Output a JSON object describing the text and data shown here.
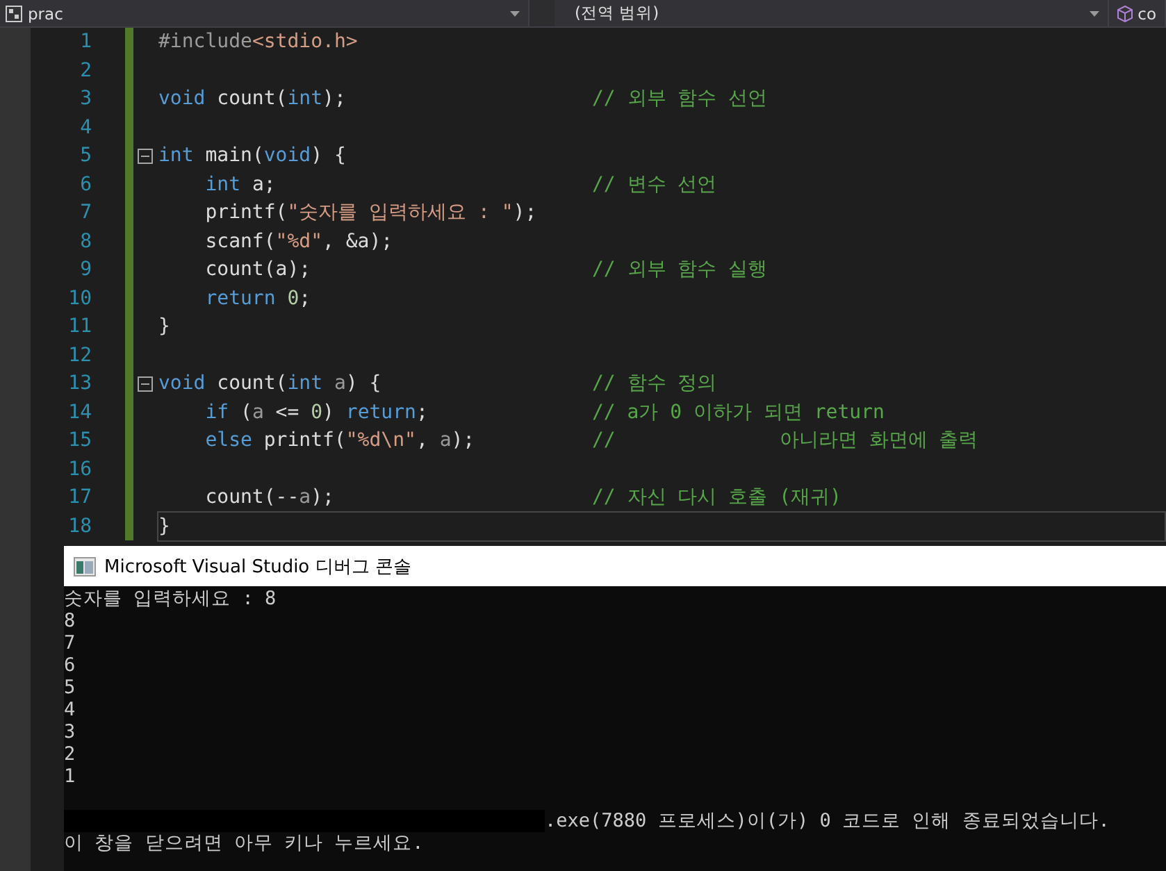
{
  "navigation_bar": {
    "project": "prac",
    "scope": "(전역 범위)",
    "member": "co"
  },
  "code_lines": [
    {
      "number": "1",
      "fold_marker": false,
      "tokens": [
        {
          "kind": "preproc",
          "text": "#include"
        },
        {
          "kind": "string",
          "text": "<stdio.h>"
        }
      ]
    },
    {
      "number": "2",
      "fold_marker": false
    },
    {
      "number": "3",
      "fold_marker": false,
      "tokens": [
        {
          "kind": "keyword",
          "text": "void"
        },
        {
          "kind": "plain",
          "text": " count("
        },
        {
          "kind": "keyword",
          "text": "int"
        },
        {
          "kind": "plain",
          "text": ");"
        }
      ],
      "comment": "// 외부 함수 선언"
    },
    {
      "number": "4",
      "fold_marker": false
    },
    {
      "number": "5",
      "fold_marker": true,
      "tokens": [
        {
          "kind": "keyword",
          "text": "int"
        },
        {
          "kind": "plain",
          "text": " main("
        },
        {
          "kind": "keyword",
          "text": "void"
        },
        {
          "kind": "plain",
          "text": ") {"
        }
      ]
    },
    {
      "number": "6",
      "fold_marker": false,
      "tokens": [
        {
          "kind": "keyword",
          "text": "    int"
        },
        {
          "kind": "plain",
          "text": " a;"
        }
      ],
      "comment": "// 변수 선언"
    },
    {
      "number": "7",
      "fold_marker": false,
      "tokens": [
        {
          "kind": "plain",
          "text": "    printf("
        },
        {
          "kind": "string",
          "text": "\"숫자를 입력하세요 : \""
        },
        {
          "kind": "plain",
          "text": ");"
        }
      ]
    },
    {
      "number": "8",
      "fold_marker": false,
      "tokens": [
        {
          "kind": "plain",
          "text": "    scanf("
        },
        {
          "kind": "string",
          "text": "\"%d\""
        },
        {
          "kind": "plain",
          "text": ", &a);"
        }
      ]
    },
    {
      "number": "9",
      "fold_marker": false,
      "tokens": [
        {
          "kind": "plain",
          "text": "    count(a);"
        }
      ],
      "comment": "// 외부 함수 실행"
    },
    {
      "number": "10",
      "fold_marker": false,
      "tokens": [
        {
          "kind": "keyword",
          "text": "    return"
        },
        {
          "kind": "number",
          "text": " 0"
        },
        {
          "kind": "plain",
          "text": ";"
        }
      ]
    },
    {
      "number": "11",
      "fold_marker": false,
      "tokens": [
        {
          "kind": "plain",
          "text": "}"
        }
      ]
    },
    {
      "number": "12",
      "fold_marker": false
    },
    {
      "number": "13",
      "fold_marker": true,
      "tokens": [
        {
          "kind": "keyword",
          "text": "void"
        },
        {
          "kind": "plain",
          "text": " count("
        },
        {
          "kind": "keyword",
          "text": "int"
        },
        {
          "kind": "param",
          "text": " a"
        },
        {
          "kind": "plain",
          "text": ") {"
        }
      ],
      "comment": "// 함수 정의"
    },
    {
      "number": "14",
      "fold_marker": false,
      "tokens": [
        {
          "kind": "keyword",
          "text": "    if"
        },
        {
          "kind": "plain",
          "text": " ("
        },
        {
          "kind": "param",
          "text": "a"
        },
        {
          "kind": "plain",
          "text": " <= "
        },
        {
          "kind": "number",
          "text": "0"
        },
        {
          "kind": "plain",
          "text": ") "
        },
        {
          "kind": "keyword",
          "text": "return"
        },
        {
          "kind": "plain",
          "text": ";"
        }
      ],
      "comment": "// a가 0 이하가 되면 return"
    },
    {
      "number": "15",
      "fold_marker": false,
      "tokens": [
        {
          "kind": "keyword",
          "text": "    else"
        },
        {
          "kind": "plain",
          "text": " printf("
        },
        {
          "kind": "string",
          "text": "\"%d\\n\""
        },
        {
          "kind": "plain",
          "text": ", "
        },
        {
          "kind": "param",
          "text": "a"
        },
        {
          "kind": "plain",
          "text": ");"
        }
      ],
      "comment": "//              아니라면 화면에 출력"
    },
    {
      "number": "16",
      "fold_marker": false
    },
    {
      "number": "17",
      "fold_marker": false,
      "tokens": [
        {
          "kind": "plain",
          "text": "    count(--"
        },
        {
          "kind": "param",
          "text": "a"
        },
        {
          "kind": "plain",
          "text": ");"
        }
      ],
      "comment": "// 자신 다시 호출 (재귀)"
    },
    {
      "number": "18",
      "fold_marker": false,
      "current": true,
      "tokens": [
        {
          "kind": "plain",
          "text": "}"
        }
      ]
    }
  ],
  "console": {
    "title": "Microsoft Visual Studio 디버그 콘솔",
    "lines": [
      {
        "kind": "text",
        "text": "숫자를 입력하세요 : 8"
      },
      {
        "kind": "text",
        "text": "8"
      },
      {
        "kind": "text",
        "text": "7"
      },
      {
        "kind": "text",
        "text": "6"
      },
      {
        "kind": "text",
        "text": "5"
      },
      {
        "kind": "text",
        "text": "4"
      },
      {
        "kind": "text",
        "text": "3"
      },
      {
        "kind": "text",
        "text": "2"
      },
      {
        "kind": "text",
        "text": "1"
      },
      {
        "kind": "blank"
      },
      {
        "kind": "redacted",
        "text": ".exe(7880 프로세스)이(가) 0 코드로 인해 종료되었습니다."
      },
      {
        "kind": "text",
        "text": "이 창을 닫으려면 아무 키나 누르세요."
      }
    ]
  }
}
